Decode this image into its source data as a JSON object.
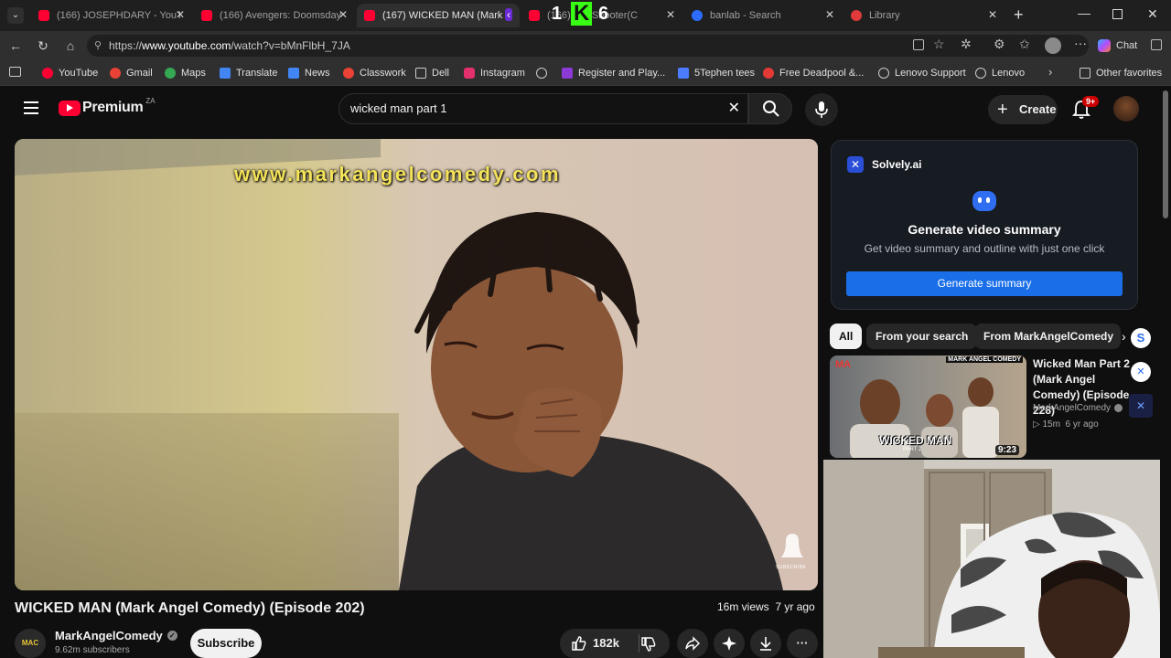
{
  "browser": {
    "tabs": [
      {
        "label": "(166) JOSEPHDARY - YouTube",
        "color": "#ff0033"
      },
      {
        "label": "(166) Avengers: Doomsday |",
        "color": "#ff0033"
      },
      {
        "label": "(167) WICKED MAN (Mark An",
        "color": "#ff0033"
      },
      {
        "label": "(166) R      e Shooter(C",
        "color": "#ff0033"
      },
      {
        "label": "banlab - Search",
        "color": "#2b6cff"
      },
      {
        "label": "Library",
        "color": "#e03a3a"
      }
    ],
    "overlay_digits": [
      "1",
      "K",
      "6"
    ],
    "url_prefix": "https://",
    "url_host": "www.youtube.com",
    "url_path": "/watch?v=bMnFlbH_7JA",
    "chat_label": "Chat",
    "bookmarks": [
      {
        "label": "YouTube",
        "color": "#ff0033"
      },
      {
        "label": "Gmail",
        "color": "#ea4335"
      },
      {
        "label": "Maps",
        "color": "#34a853"
      },
      {
        "label": "Translate",
        "color": "#4285f4"
      },
      {
        "label": "News",
        "color": "#4285f4"
      },
      {
        "label": "Classwork",
        "color": "#ea4335"
      },
      {
        "label": "Dell",
        "color": "#9aa0a6"
      },
      {
        "label": "Instagram",
        "color": "#e1306c"
      },
      {
        "label": "Register and Play...",
        "color": "#8b3ad6"
      },
      {
        "label": "5Tephen tees",
        "color": "#4a7dff"
      },
      {
        "label": "Free Deadpool &...",
        "color": "#e53935"
      },
      {
        "label": "Lenovo Support",
        "color": "#9aa0a6"
      },
      {
        "label": "Lenovo",
        "color": "#9aa0a6"
      },
      {
        "label": "Other favorites",
        "color": "#9aa0a6"
      }
    ]
  },
  "youtube": {
    "logo_text": "Premium",
    "region": "ZA",
    "search_value": "wicked man part 1",
    "create_label": "Create",
    "notif_count": "9+"
  },
  "video": {
    "watermark": "www.markangelcomedy.com",
    "title": "WICKED MAN (Mark Angel Comedy) (Episode 202)",
    "views": "16m views",
    "age": "7 yr ago",
    "channel": "MarkAngelComedy",
    "channel_avatar": "MAC",
    "subscribers": "9.62m subscribers",
    "subscribe_label": "Subscribe",
    "likes": "182k",
    "subscribe_overlay": "SUBSCRIBE"
  },
  "solvely": {
    "brand": "Solvely.ai",
    "heading": "Generate video summary",
    "subtext": "Get video summary and outline with just one click",
    "button": "Generate summary"
  },
  "chips": [
    "All",
    "From your search",
    "From MarkAngelComedy"
  ],
  "recommendation": {
    "title": "Wicked Man Part 2 (Mark Angel Comedy) (Episode 228)",
    "channel": "MarkAngelComedy",
    "views": "15m",
    "age": "6 yr ago",
    "duration": "9:23",
    "thumb_text": "WICKED MAN",
    "thumb_sub": "PART 2",
    "thumb_brand": "MARK ANGEL COMEDY"
  }
}
